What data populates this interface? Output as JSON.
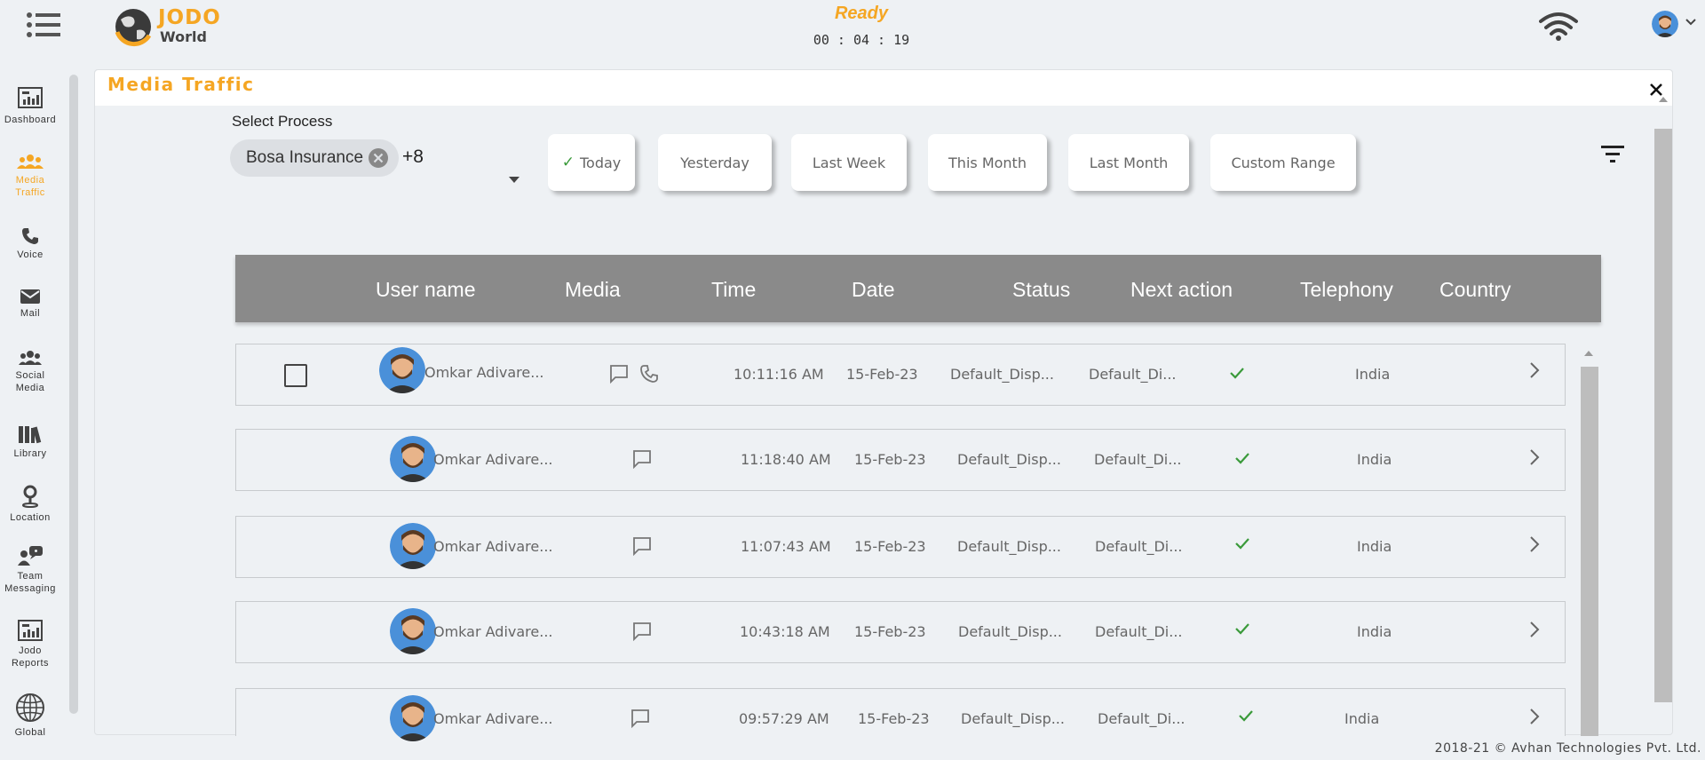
{
  "header": {
    "brand_top": "JODO",
    "brand_bottom": "World",
    "status": "Ready",
    "timer": "00 : 04 : 19"
  },
  "sidebar": {
    "items": [
      {
        "label": "Dashboard",
        "icon": "dashboard-icon"
      },
      {
        "label": "Media Traffic",
        "icon": "people-group-icon"
      },
      {
        "label": "Voice",
        "icon": "phone-icon"
      },
      {
        "label": "Mail",
        "icon": "mail-icon"
      },
      {
        "label": "Social Media",
        "icon": "users-icon"
      },
      {
        "label": "Library",
        "icon": "books-icon"
      },
      {
        "label": "Location",
        "icon": "location-pin-icon"
      },
      {
        "label": "Team Messaging",
        "icon": "team-chat-icon"
      },
      {
        "label": "Jodo Reports",
        "icon": "report-icon"
      },
      {
        "label": "Global",
        "icon": "globe-icon"
      }
    ]
  },
  "panel": {
    "title": "Media Traffic",
    "select_process_label": "Select Process",
    "selected_process": "Bosa Insurance",
    "more_count": "+8"
  },
  "date_filters": [
    {
      "label": "Today",
      "selected": true
    },
    {
      "label": "Yesterday",
      "selected": false
    },
    {
      "label": "Last Week",
      "selected": false
    },
    {
      "label": "This Month",
      "selected": false
    },
    {
      "label": "Last Month",
      "selected": false
    },
    {
      "label": "Custom Range",
      "selected": false
    }
  ],
  "table": {
    "columns": [
      "User name",
      "Media",
      "Time",
      "Date",
      "Status",
      "Next action",
      "Telephony",
      "Country"
    ],
    "rows": [
      {
        "user": "Omkar Adivare...",
        "media": [
          "chat",
          "phone"
        ],
        "time": "10:11:16 AM",
        "date": "15-Feb-23",
        "status": "Default_Disp...",
        "next_action": "Default_Di...",
        "telephony": "check",
        "country": "India",
        "has_checkbox": true
      },
      {
        "user": "Omkar Adivare...",
        "media": [
          "chat"
        ],
        "time": "11:18:40 AM",
        "date": "15-Feb-23",
        "status": "Default_Disp...",
        "next_action": "Default_Di...",
        "telephony": "check",
        "country": "India",
        "has_checkbox": false
      },
      {
        "user": "Omkar Adivare...",
        "media": [
          "chat"
        ],
        "time": "11:07:43 AM",
        "date": "15-Feb-23",
        "status": "Default_Disp...",
        "next_action": "Default_Di...",
        "telephony": "check",
        "country": "India",
        "has_checkbox": false
      },
      {
        "user": "Omkar Adivare...",
        "media": [
          "chat"
        ],
        "time": "10:43:18 AM",
        "date": "15-Feb-23",
        "status": "Default_Disp...",
        "next_action": "Default_Di...",
        "telephony": "check",
        "country": "India",
        "has_checkbox": false
      },
      {
        "user": "Omkar Adivare...",
        "media": [
          "chat"
        ],
        "time": "09:57:29 AM",
        "date": "15-Feb-23",
        "status": "Default_Disp...",
        "next_action": "Default_Di...",
        "telephony": "check",
        "country": "India",
        "has_checkbox": false
      }
    ]
  },
  "footer": {
    "text": "2018-21 © Avhan Technologies Pvt. Ltd."
  },
  "colors": {
    "accent": "#f5a623",
    "header_gray": "#8a8a8a",
    "check_green": "#3a9a3a",
    "avatar_blue": "#4a90d9"
  }
}
